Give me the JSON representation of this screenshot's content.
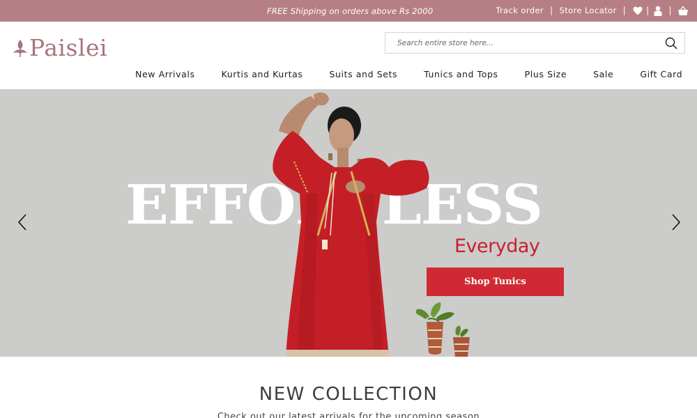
{
  "topbar": {
    "promo": "FREE Shipping on orders above Rs 2000",
    "track_order": "Track order",
    "store_locator": "Store Locator",
    "separator": "|",
    "bg_color": "#b67f86"
  },
  "header": {
    "logo_text": "Paislei",
    "search_placeholder": "Search entire store here..."
  },
  "nav": {
    "items": [
      {
        "label": "New Arrivals"
      },
      {
        "label": "Kurtis and Kurtas"
      },
      {
        "label": "Suits and Sets"
      },
      {
        "label": "Tunics and Tops"
      },
      {
        "label": "Plus Size"
      },
      {
        "label": "Sale"
      },
      {
        "label": "Gift Card"
      }
    ]
  },
  "hero": {
    "headline": "EFFORTLESS",
    "subheadline": "Everyday",
    "cta": "Shop Tunics",
    "accent_color": "#cf2a33"
  },
  "section": {
    "title": "NEW COLLECTION",
    "subtitle": "Check out our latest arrivals for the upcoming season"
  }
}
